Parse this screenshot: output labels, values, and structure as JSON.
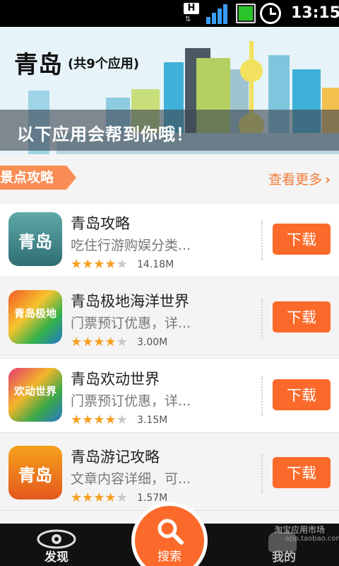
{
  "status_bar": {
    "network_letter": "H",
    "time": "13:15"
  },
  "banner": {
    "title": "青岛",
    "count": "(共9个应用)",
    "subtitle": "以下应用会帮到你哦！"
  },
  "section": {
    "label": "景点攻略",
    "see_more": "查看更多",
    "see_more_chevron": "›"
  },
  "apps": [
    {
      "name": "青岛攻略",
      "desc": "吃住行游购娱分类...",
      "rating": 4,
      "max_rating": 5,
      "size": "14.18M",
      "button": "下载",
      "icon_text": "青岛",
      "icon": "qingdao-guide-icon"
    },
    {
      "name": "青岛极地海洋世界",
      "desc": "门票预订优惠，详...",
      "rating": 4,
      "max_rating": 5,
      "size": "3.00M",
      "button": "下载",
      "icon_text": "青岛极地",
      "icon": "polar-ocean-icon"
    },
    {
      "name": "青岛欢动世界",
      "desc": "门票预订优惠，详...",
      "rating": 4,
      "max_rating": 5,
      "size": "3.15M",
      "button": "下载",
      "icon_text": "欢动世界",
      "icon": "joy-world-icon"
    },
    {
      "name": "青岛游记攻略",
      "desc": "文章内容详细，可...",
      "rating": 4,
      "max_rating": 5,
      "size": "1.57M",
      "button": "下载",
      "icon_text": "青岛",
      "icon": "travel-notes-icon"
    }
  ],
  "bottom_nav": {
    "discover": "发现",
    "search": "搜索",
    "mine": "我的",
    "watermark": "淘宝应用市场",
    "watermark_url": "app.taobao.com"
  },
  "colors": {
    "accent": "#fb6a2a",
    "tag": "#f98d55",
    "star": "#f6a023"
  }
}
